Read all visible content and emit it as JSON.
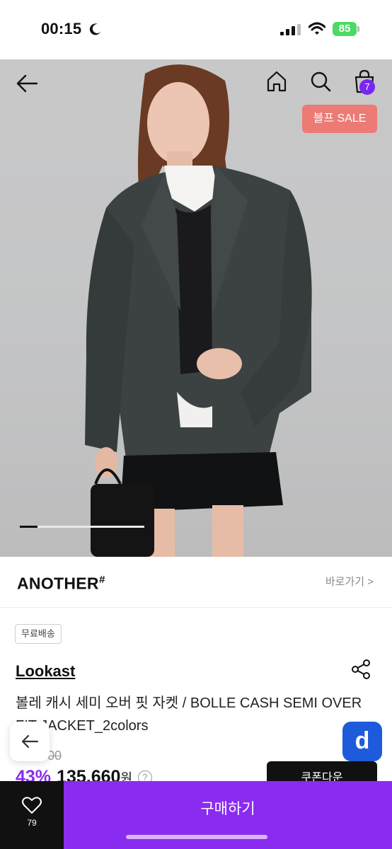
{
  "status_bar": {
    "time": "00:15",
    "battery": "85"
  },
  "header": {
    "cart_count": "7",
    "sale_badge": "블프 SALE"
  },
  "gallery": {
    "current_progress": 0.14
  },
  "brand": {
    "name": "ANOTHER",
    "mark": "#",
    "shortcut_label": "바로가기 >"
  },
  "product": {
    "shipping_tag": "무료배송",
    "seller": "Lookast",
    "title": "볼레 캐시 세미 오버 핏 자켓 / BOLLE CASH SEMI OVER FIT JACKET_2colors",
    "original_price": "238,000",
    "discount_rate": "43%",
    "sale_price": "135,660",
    "price_unit": "원",
    "info_symbol": "?"
  },
  "floating": {
    "app_badge": "d",
    "coupon_label": "쿠폰다운"
  },
  "bottom_bar": {
    "like_count": "79",
    "buy_label": "구매하기"
  },
  "colors": {
    "accent": "#8a2bf0",
    "sale_badge": "#ec7a75",
    "app_badge": "#1d5bdc"
  },
  "icons": [
    "moon-icon",
    "signal-icon",
    "wifi-icon",
    "back-icon",
    "home-icon",
    "search-icon",
    "bag-icon",
    "share-icon",
    "heart-icon"
  ]
}
